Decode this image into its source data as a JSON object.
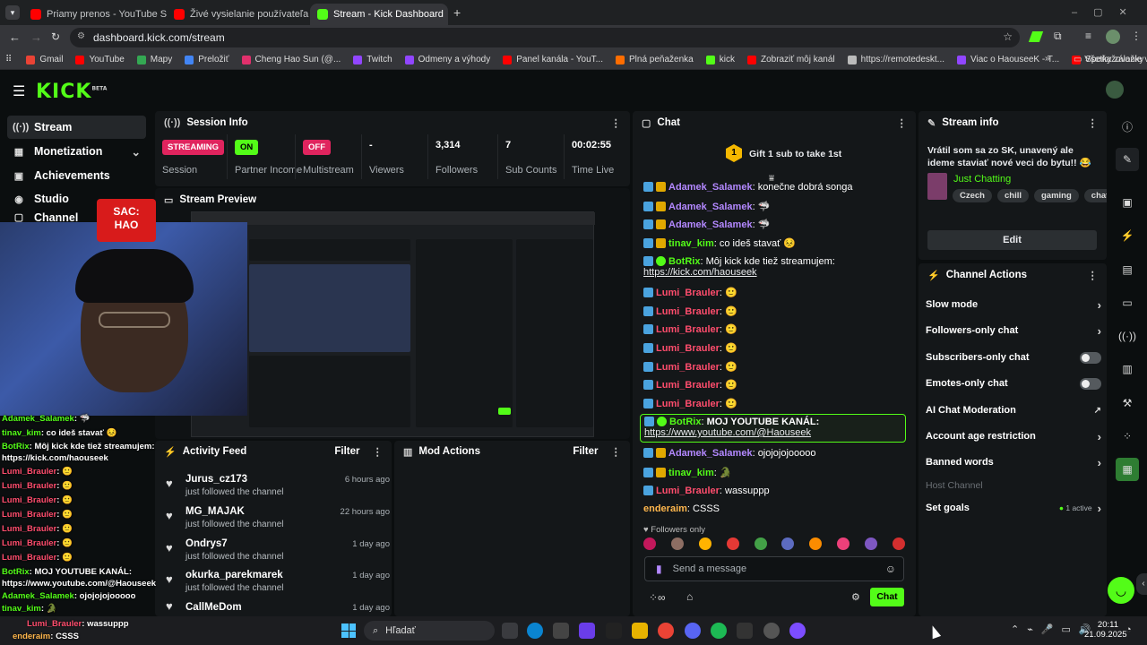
{
  "browser": {
    "tabs": [
      {
        "title": "Priamy prenos - YouTube Studio",
        "color": "#ff0000",
        "active": false
      },
      {
        "title": "Živé vysielanie používateľa Hao",
        "color": "#ff0000",
        "active": false
      },
      {
        "title": "Stream - Kick Dashboard",
        "color": "#53fc18",
        "active": true
      }
    ],
    "url": "dashboard.kick.com/stream",
    "bookmarks": [
      "Gmail",
      "YouTube",
      "Mapy",
      "Preložiť",
      "Cheng Hao Sun (@...",
      "Twitch",
      "Odmeny a výhody",
      "Panel kanála - YouT...",
      "Plná peňaženka",
      "kick",
      "Zobraziť môj kanál",
      "https://remotedeskt...",
      "Viac o HaouseeK - T...",
      "Speňažovanie videa..."
    ],
    "all_bookmarks": "Všetky záložky"
  },
  "header": {
    "logo": "KICK",
    "beta": "BETA"
  },
  "sidebar": {
    "items": [
      {
        "label": "Stream",
        "icon": "signal-icon"
      },
      {
        "label": "Monetization",
        "icon": "dollar-icon"
      },
      {
        "label": "Achievements",
        "icon": "trophy-icon"
      },
      {
        "label": "Studio",
        "icon": "studio-icon"
      },
      {
        "label": "Channel",
        "icon": "channel-icon"
      }
    ]
  },
  "session": {
    "title": "Session Info",
    "stats": [
      {
        "value": "STREAMING",
        "label": "Session",
        "badge": "#e0245e"
      },
      {
        "value": "ON",
        "label": "Partner Income",
        "badge": "#53fc18"
      },
      {
        "value": "OFF",
        "label": "Multistream",
        "badge": "#e0245e"
      },
      {
        "value": "-",
        "label": "Viewers"
      },
      {
        "value": "3,314",
        "label": "Followers"
      },
      {
        "value": "7",
        "label": "Sub Counts"
      },
      {
        "value": "00:02:55",
        "label": "Time Live"
      }
    ]
  },
  "preview": {
    "title": "Stream Preview"
  },
  "webcam_badge": {
    "line1": "SAC:",
    "line2": "HAO"
  },
  "activity": {
    "title": "Activity Feed",
    "filter": "Filter",
    "items": [
      {
        "name": "Jurus_cz173",
        "text": "just followed the channel",
        "time": "6 hours ago"
      },
      {
        "name": "MG_MAJAK",
        "text": "just followed the channel",
        "time": "22 hours ago"
      },
      {
        "name": "Ondrys7",
        "text": "just followed the channel",
        "time": "1 day ago"
      },
      {
        "name": "okurka_parekmarek",
        "text": "just followed the channel",
        "time": "1 day ago"
      },
      {
        "name": "CallMeDom",
        "text": "",
        "time": "1 day ago"
      }
    ]
  },
  "mod": {
    "title": "Mod Actions",
    "filter": "Filter"
  },
  "chat": {
    "title": "Chat",
    "gift_num": "1",
    "gift_text": "Gift 1 sub to take 1st",
    "messages": [
      {
        "user": "Adamek_Salamek",
        "color": "#b388ff",
        "text": "konečne dobrá songa"
      },
      {
        "user": "Adamek_Salamek",
        "color": "#b388ff",
        "text": "🦈"
      },
      {
        "user": "Adamek_Salamek",
        "color": "#b388ff",
        "text": "🦈"
      },
      {
        "user": "tinav_kim",
        "color": "#53fc18",
        "text": "co ideš stavať 😣"
      },
      {
        "user": "BotRix",
        "color": "#53fc18",
        "text": "Môj kick kde tiež streamujem:",
        "link": "https://kick.com/haouseek"
      },
      {
        "user": "Lumi_Brauler",
        "color": "#ff4d6d",
        "text": "🙂"
      },
      {
        "user": "Lumi_Brauler",
        "color": "#ff4d6d",
        "text": "🙂"
      },
      {
        "user": "Lumi_Brauler",
        "color": "#ff4d6d",
        "text": "🙂"
      },
      {
        "user": "Lumi_Brauler",
        "color": "#ff4d6d",
        "text": "🙂"
      },
      {
        "user": "Lumi_Brauler",
        "color": "#ff4d6d",
        "text": "🙂"
      },
      {
        "user": "Lumi_Brauler",
        "color": "#ff4d6d",
        "text": "🙂"
      },
      {
        "user": "Lumi_Brauler",
        "color": "#ff4d6d",
        "text": "🙂"
      },
      {
        "user": "BotRix",
        "color": "#53fc18",
        "text": "MOJ YOUTUBE KANÁL:",
        "link": "https://www.youtube.com/@Haouseek"
      },
      {
        "user": "Adamek_Salamek",
        "color": "#b388ff",
        "text": "ojojojojooooo"
      },
      {
        "user": "tinav_kim",
        "color": "#53fc18",
        "text": "🐊"
      },
      {
        "user": "Lumi_Brauler",
        "color": "#ff4d6d",
        "text": "wassuppp"
      },
      {
        "user": "enderaim",
        "color": "#ffb74d",
        "text": "CSSS"
      }
    ],
    "followers_only": "Followers only",
    "placeholder": "Send a message",
    "send": "Chat"
  },
  "stream_info": {
    "title": "Stream info",
    "text": "Vrátil som sa zo SK, unavený ale ideme staviať nové veci do bytu!! 😂",
    "category": "Just Chatting",
    "tags": [
      "Czech",
      "chill",
      "gaming",
      "chatting"
    ],
    "edit": "Edit"
  },
  "channel_actions": {
    "title": "Channel Actions",
    "items": [
      {
        "label": "Slow mode",
        "kind": "arrow"
      },
      {
        "label": "Followers-only chat",
        "kind": "arrow"
      },
      {
        "label": "Subscribers-only chat",
        "kind": "toggle"
      },
      {
        "label": "Emotes-only chat",
        "kind": "toggle"
      },
      {
        "label": "AI Chat Moderation",
        "kind": "external"
      },
      {
        "label": "Account age restriction",
        "kind": "arrow"
      },
      {
        "label": "Banned words",
        "kind": "arrow"
      },
      {
        "label": "Host Channel",
        "kind": "disabled"
      },
      {
        "label": "Set goals",
        "kind": "arrow",
        "status": "1 active"
      }
    ]
  },
  "overlay_chat": [
    {
      "user": "Adamek_Salamek",
      "text": "🦈"
    },
    {
      "user": "tinav_kim",
      "text": "co ideš stavať 😣"
    },
    {
      "user": "BotRix",
      "text": "Môj kick kde tiež streamujem:"
    },
    {
      "user": "",
      "text": "https://kick.com/haouseek"
    },
    {
      "user": "Lumi_Brauler",
      "text": "🙂"
    },
    {
      "user": "Lumi_Brauler",
      "text": "🙂"
    },
    {
      "user": "Lumi_Brauler",
      "text": "🙂"
    },
    {
      "user": "Lumi_Brauler",
      "text": "🙂"
    },
    {
      "user": "Lumi_Brauler",
      "text": "🙂"
    },
    {
      "user": "Lumi_Brauler",
      "text": "🙂"
    },
    {
      "user": "Lumi_Brauler",
      "text": "🙂"
    },
    {
      "user": "BotRix",
      "text": "MOJ YOUTUBE KANÁL:"
    },
    {
      "user": "",
      "text": "https://www.youtube.com/@Haouseek"
    },
    {
      "user": "Adamek_Salamek",
      "text": "ojojojojooooo"
    },
    {
      "user": "tinav_kim",
      "text": "🐊"
    },
    {
      "user": "Lumi_Brauler",
      "text": "wassuppp"
    },
    {
      "user": "enderaim",
      "text": "CSSS"
    }
  ],
  "taskbar": {
    "search": "Hľadať",
    "time": "20:11",
    "date": "21.09.2025"
  },
  "colors": {
    "accent": "#53fc18",
    "live": "#e0245e",
    "panel": "#141719"
  }
}
